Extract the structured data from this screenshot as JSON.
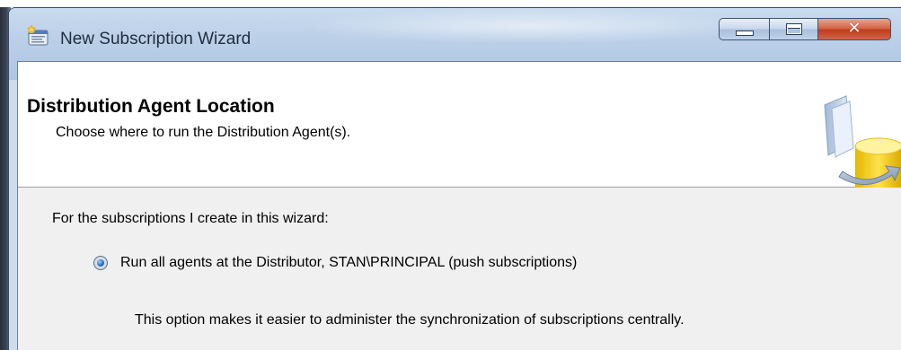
{
  "window": {
    "title": "New Subscription Wizard",
    "app_icon": "wizard-app-icon",
    "caption_buttons": {
      "minimize_icon": "minimize-icon",
      "maximize_icon": "maximize-icon",
      "close_icon": "close-icon"
    }
  },
  "header": {
    "title": "Distribution Agent Location",
    "subtitle": "Choose where to run the Distribution Agent(s).",
    "graphic_icon": "database-sync-icon"
  },
  "body": {
    "section_label": "For the subscriptions I create in this wizard:",
    "options": [
      {
        "label": "Run all agents at the Distributor, STAN\\PRINCIPAL (push subscriptions)",
        "selected": true,
        "description": "This option makes it easier to administer the synchronization of subscriptions centrally."
      }
    ]
  },
  "colors": {
    "titlebar": "#bcd0e8",
    "close_button": "#c13c1c",
    "header_background": "#ffffff",
    "body_background": "#f0f0f0",
    "radio_selected": "#2c6fc6"
  }
}
